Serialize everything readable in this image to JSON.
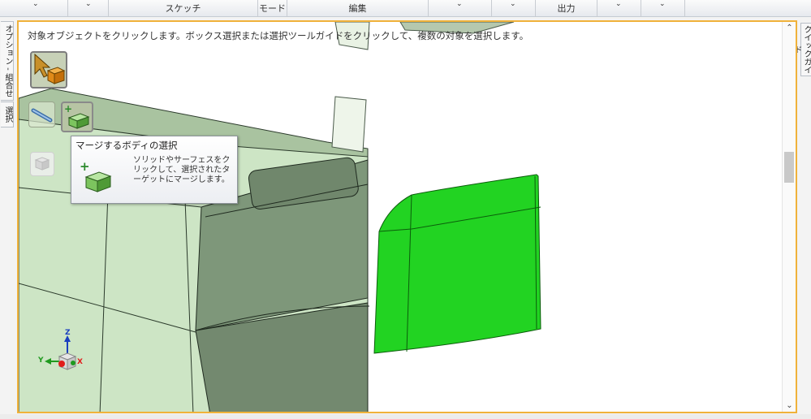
{
  "ribbon": {
    "groups": [
      {
        "label": ""
      },
      {
        "label": ""
      },
      {
        "label": "スケッチ"
      },
      {
        "label": "モード"
      },
      {
        "label": "編集"
      },
      {
        "label": ""
      },
      {
        "label": ""
      },
      {
        "label": "出力"
      },
      {
        "label": ""
      },
      {
        "label": ""
      }
    ]
  },
  "left_tabs": {
    "options": "オプション - 組合せ",
    "selection": "選択"
  },
  "right_tab": {
    "quick_guide": "クイックガイド"
  },
  "viewport": {
    "hint": "対象オブジェクトをクリックします。ボックス選択または選択ツールガイドをクリックして、複数の対象を選択します。"
  },
  "tools": {
    "select_icon": "select-target-icon",
    "pull_icon": "pull-tool-icon",
    "merge_icon": "merge-body-icon",
    "ghost_icon": "cube-icon"
  },
  "tooltip": {
    "title": "マージするボディの選択",
    "description": "ソリッドやサーフェスをクリックして、選択されたターゲットにマージします。"
  },
  "triad": {
    "z": "Z",
    "y": "Y",
    "x": "X"
  },
  "colors": {
    "viewport_border": "#f0b23a",
    "selected_body": "#22d322",
    "body_face": "#7e977a",
    "body_light": "#cde5c5"
  }
}
